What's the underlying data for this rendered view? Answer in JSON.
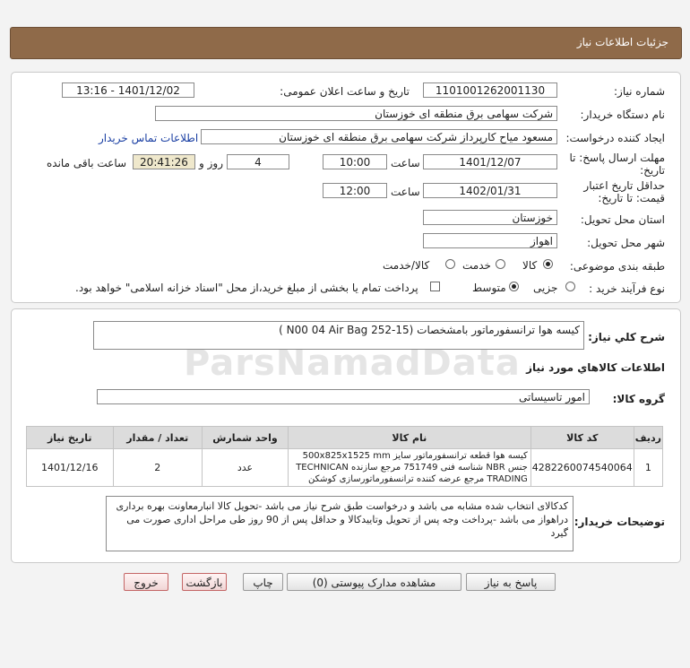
{
  "header": {
    "title": "جزئیات اطلاعات نیاز"
  },
  "details": {
    "need_number_label": "شماره نیاز:",
    "need_number": "1101001262001130",
    "announce_label": "تاریخ و ساعت اعلان عمومی:",
    "announce_value": "1401/12/02 - 13:16",
    "buyer_label": "نام دستگاه خریدار:",
    "buyer_value": "شرکت سهامی برق منطقه ای خوزستان",
    "requester_label": "ایجاد کننده درخواست:",
    "requester_value": "مسعود میاح کارپرداز شرکت سهامی برق منطقه ای خوزستان",
    "contact_link": "اطلاعات تماس خریدار",
    "deadline_label_1": "مهلت ارسال پاسخ: تا",
    "deadline_label_2": "تاریخ:",
    "deadline_date": "1401/12/07",
    "time_label": "ساعت",
    "deadline_time": "10:00",
    "days_value": "4",
    "days_label": "روز و",
    "remaining_value": "20:41:26",
    "remaining_label": "ساعت باقی مانده",
    "validity_label_1": "حداقل تاریخ اعتبار",
    "validity_label_2": "قیمت: تا تاریخ:",
    "validity_date": "1402/01/31",
    "validity_time": "12:00",
    "province_label": "استان محل تحویل:",
    "province_value": "خوزستان",
    "city_label": "شهر محل تحویل:",
    "city_value": "اهواز",
    "category_label": "طبقه بندی موضوعی:",
    "category_options": [
      "کالا",
      "خدمت",
      "کالا/خدمت"
    ],
    "process_label": "نوع فرآیند خرید :",
    "process_options": [
      "جزیی",
      "متوسط"
    ],
    "payment_note": "پرداخت تمام یا بخشی از مبلغ خرید،از محل \"اسناد خزانه اسلامی\" خواهد بود."
  },
  "summary": {
    "general_label": "شرح کلي نياز:",
    "general_value": "کیسه هوا ترانسفورماتور بامشخصات (15-252 N00 04  Air Bag )",
    "goods_info_title": "اطلاعات کالاهاي مورد نياز",
    "group_label": "گروه کالا:",
    "group_value": "امور تاسیساتی",
    "watermark": "ParsNamadData"
  },
  "table": {
    "headers": [
      "ردیف",
      "کد کالا",
      "نام کالا",
      "واحد شمارش",
      "تعداد / مقدار",
      "تاریخ نیاز"
    ],
    "rows": [
      {
        "index": "1",
        "code": "4282260074540064",
        "name": "کیسه هوا قطعه ترانسفورماتور سایز 500x825x1525 mm جنس NBR شناسه فنی 751749 مرجع سازنده TECHNICAN TRADING مرجع عرضه کننده ترانسفورماتورسازی کوشکن",
        "unit": "عدد",
        "qty": "2",
        "date": "1401/12/16"
      }
    ]
  },
  "notes": {
    "label": "توضیحات خریدار:",
    "text": "کدکالای انتخاب شده مشابه می باشد و درخواست طبق شرح نیاز می باشد -تحویل کالا انبارمعاونت بهره برداری دراهواز می باشد -پرداخت وجه پس از تحویل وتاییدکالا و حداقل پس از 90 روز طی مراحل اداری صورت می گیرد"
  },
  "buttons": {
    "reply": "پاسخ به نیاز",
    "attachments": "مشاهده مدارک پیوستی (0)",
    "print": "چاپ",
    "back": "بازگشت",
    "exit": "خروج"
  }
}
